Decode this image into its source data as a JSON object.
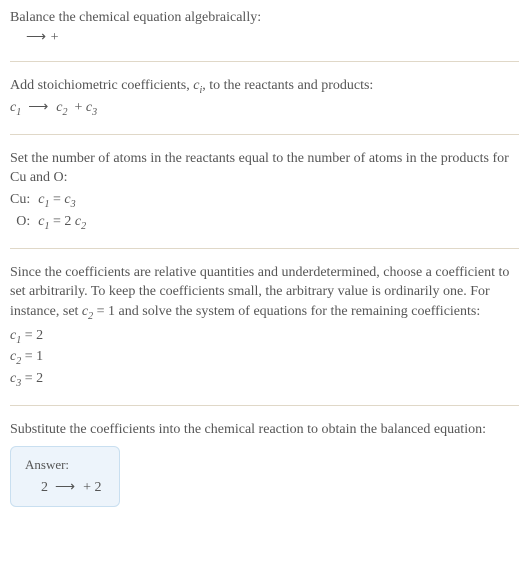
{
  "section1": {
    "line1": "Balance the chemical equation algebraically:",
    "line2_arrow": "⟶",
    "line2_plus": "+"
  },
  "section2": {
    "line1_prefix": "Add stoichiometric coefficients, ",
    "line1_ci_c": "c",
    "line1_ci_i": "i",
    "line1_suffix": ", to the reactants and products:",
    "eq_c1_c": "c",
    "eq_c1_n": "1",
    "eq_arrow": "⟶",
    "eq_c2_c": "c",
    "eq_c2_n": "2",
    "eq_plus": "+",
    "eq_c3_c": "c",
    "eq_c3_n": "3"
  },
  "section3": {
    "text": "Set the number of atoms in the reactants equal to the number of atoms in the products for Cu and O:",
    "rows": [
      {
        "label": "Cu:",
        "lhs_c": "c",
        "lhs_n": "1",
        "op": " = ",
        "rhs_c": "c",
        "rhs_n": "3",
        "rhs_prefix": ""
      },
      {
        "label": "O:",
        "lhs_c": "c",
        "lhs_n": "1",
        "op": " = ",
        "rhs_c": "c",
        "rhs_n": "2",
        "rhs_prefix": "2 "
      }
    ]
  },
  "section4": {
    "line1": "Since the coefficients are relative quantities and underdetermined, choose a coefficient to set arbitrarily. To keep the coefficients small, the arbitrary value is ordinarily one. For instance, set ",
    "set_c": "c",
    "set_n": "2",
    "set_val": " = 1",
    "line1_suffix": " and solve the system of equations for the remaining coefficients:",
    "coeffs": [
      {
        "c": "c",
        "n": "1",
        "val": " = 2"
      },
      {
        "c": "c",
        "n": "2",
        "val": " = 1"
      },
      {
        "c": "c",
        "n": "3",
        "val": " = 2"
      }
    ]
  },
  "section5": {
    "text": "Substitute the coefficients into the chemical reaction to obtain the balanced equation:"
  },
  "answer": {
    "label": "Answer:",
    "lhs": "2 ",
    "arrow": "⟶",
    "rhs": " + 2"
  }
}
